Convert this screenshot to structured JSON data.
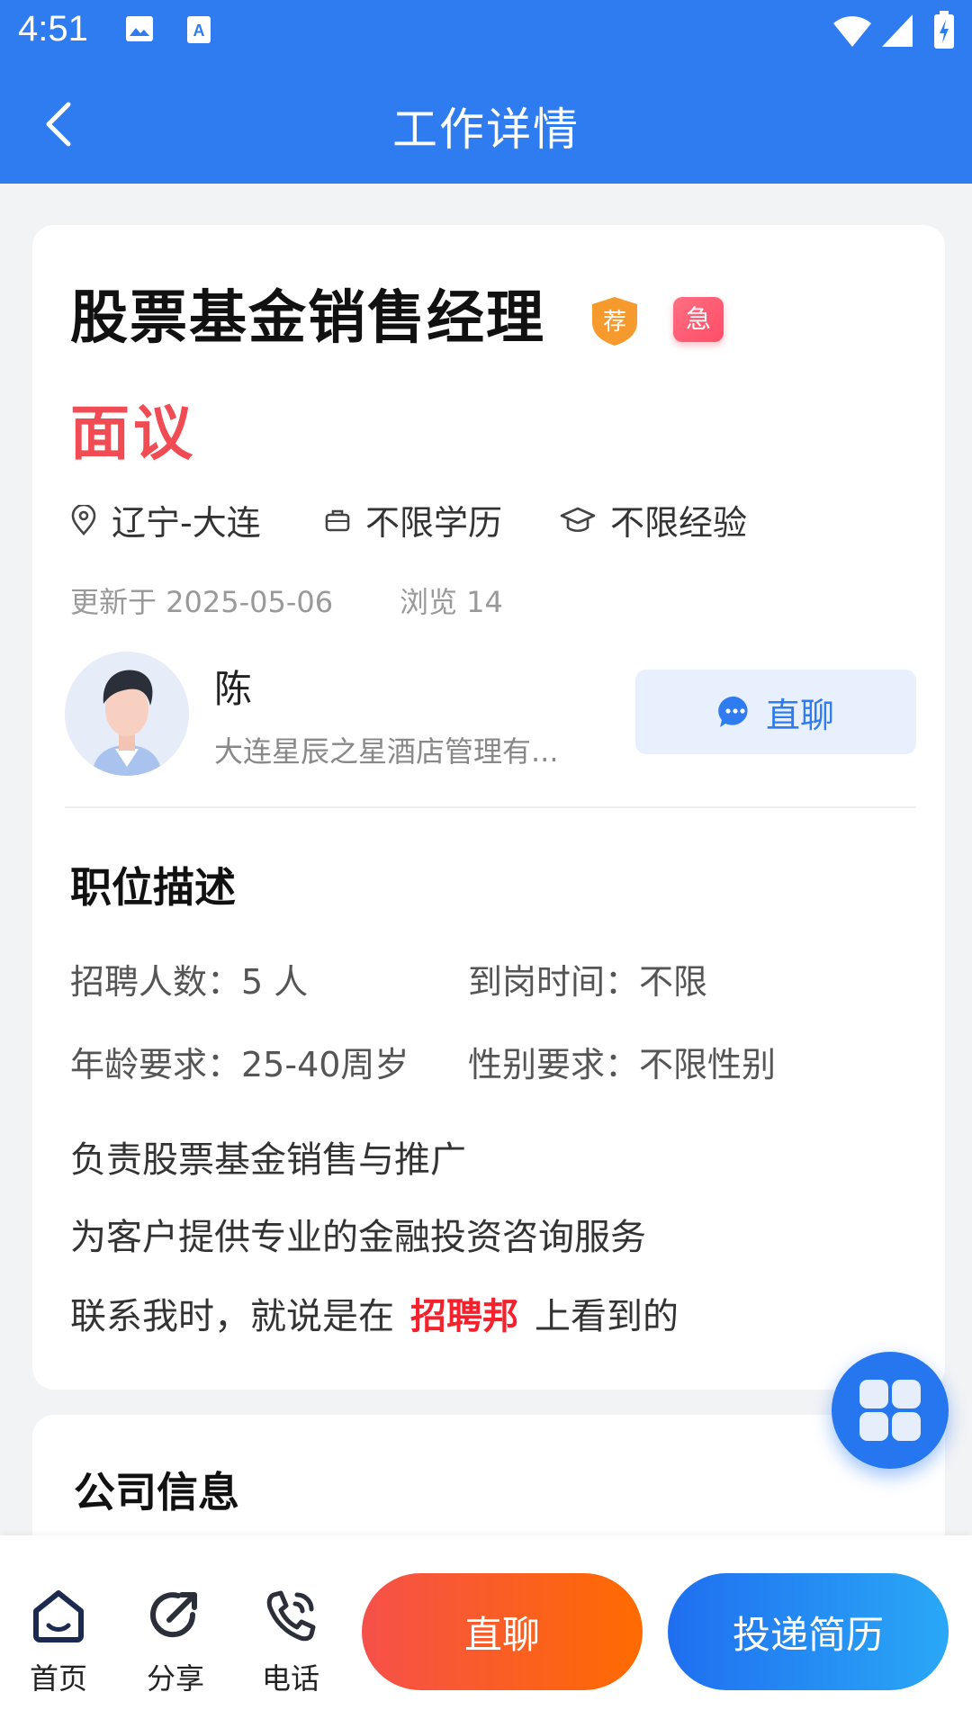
{
  "status_bar": {
    "time": "4:51"
  },
  "header": {
    "title": "工作详情"
  },
  "job": {
    "title": "股票基金销售经理",
    "badge_recommended": "荐",
    "badge_urgent": "急",
    "salary": "面议",
    "location": "辽宁-大连",
    "education": "不限学历",
    "experience": "不限经验",
    "updated": "更新于 2025-05-06",
    "views": "浏览 14"
  },
  "contact": {
    "name": "陈",
    "company": "大连星辰之星酒店管理有...",
    "chat_label": "直聊"
  },
  "description": {
    "title": "职位描述",
    "recruit_count": "招聘人数：5 人",
    "start_time": "到岗时间：不限",
    "age": "年龄要求：25-40周岁",
    "gender": "性别要求：不限性别",
    "lines": [
      "负责股票基金销售与推广",
      "为客户提供专业的金融投资咨询服务"
    ],
    "contact_prefix": "联系我时，就说是在",
    "contact_highlight": "招聘邦",
    "contact_suffix": "上看到的"
  },
  "company_section": {
    "title": "公司信息"
  },
  "bottom": {
    "home": "首页",
    "share": "分享",
    "phone": "电话",
    "chat": "直聊",
    "apply": "投递简历"
  }
}
